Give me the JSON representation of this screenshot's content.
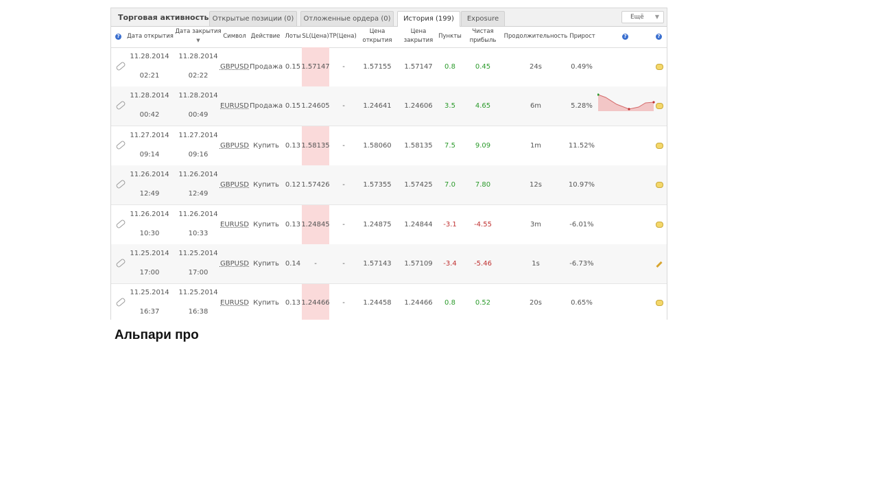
{
  "tabs": {
    "title": "Торговая активность",
    "items": [
      {
        "label": "Открытые позиции (0)"
      },
      {
        "label": "Отложенные ордера (0)"
      },
      {
        "label": "История (199)"
      },
      {
        "label": "Exposure"
      }
    ],
    "active": "История (199)",
    "more_label": "Ещё"
  },
  "columns": {
    "open_date": "Дата открытия",
    "close_date": "Дата закрытия",
    "symbol": "Символ",
    "action": "Действие",
    "lots": "Лоты",
    "sl": "SL(Цена)",
    "tp": "TP(Цена)",
    "open_price_1": "Цена",
    "open_price_2": "открытия",
    "close_price_1": "Цена",
    "close_price_2": "закрытия",
    "points": "Пункты",
    "net_profit_1": "Чистая",
    "net_profit_2": "прибыль",
    "duration": "Продолжительность",
    "growth": "Прирост"
  },
  "rows": [
    {
      "open_date": "11.28.2014",
      "open_time": "02:21",
      "close_date": "11.28.2014",
      "close_time": "02:22",
      "symbol": "GBPUSD",
      "action": "Продажа",
      "lots": "0.15",
      "sl": "1.57147",
      "tp": "-",
      "open_price": "1.57155",
      "close_price": "1.57147",
      "points": "0.8",
      "profit": "0.45",
      "duration": "24s",
      "growth": "0.49%",
      "icon": "note-icon"
    },
    {
      "open_date": "11.28.2014",
      "open_time": "00:42",
      "close_date": "11.28.2014",
      "close_time": "00:49",
      "symbol": "EURUSD",
      "action": "Продажа",
      "lots": "0.15",
      "sl": "1.24605",
      "tp": "-",
      "open_price": "1.24641",
      "close_price": "1.24606",
      "points": "3.5",
      "profit": "4.65",
      "duration": "6m",
      "growth": "5.28%",
      "icon": "note-icon"
    },
    {
      "open_date": "11.27.2014",
      "open_time": "09:14",
      "close_date": "11.27.2014",
      "close_time": "09:16",
      "symbol": "GBPUSD",
      "action": "Купить",
      "lots": "0.13",
      "sl": "1.58135",
      "tp": "-",
      "open_price": "1.58060",
      "close_price": "1.58135",
      "points": "7.5",
      "profit": "9.09",
      "duration": "1m",
      "growth": "11.52%",
      "icon": "note-icon"
    },
    {
      "open_date": "11.26.2014",
      "open_time": "12:49",
      "close_date": "11.26.2014",
      "close_time": "12:49",
      "symbol": "GBPUSD",
      "action": "Купить",
      "lots": "0.12",
      "sl": "1.57426",
      "tp": "-",
      "open_price": "1.57355",
      "close_price": "1.57425",
      "points": "7.0",
      "profit": "7.80",
      "duration": "12s",
      "growth": "10.97%",
      "icon": "note-icon"
    },
    {
      "open_date": "11.26.2014",
      "open_time": "10:30",
      "close_date": "11.26.2014",
      "close_time": "10:33",
      "symbol": "EURUSD",
      "action": "Купить",
      "lots": "0.13",
      "sl": "1.24845",
      "tp": "-",
      "open_price": "1.24875",
      "close_price": "1.24844",
      "points": "-3.1",
      "profit": "-4.55",
      "duration": "3m",
      "growth": "-6.01%",
      "icon": "note-icon"
    },
    {
      "open_date": "11.25.2014",
      "open_time": "17:00",
      "close_date": "11.25.2014",
      "close_time": "17:00",
      "symbol": "GBPUSD",
      "action": "Купить",
      "lots": "0.14",
      "sl": "-",
      "tp": "-",
      "open_price": "1.57143",
      "close_price": "1.57109",
      "points": "-3.4",
      "profit": "-5.46",
      "duration": "1s",
      "growth": "-6.73%",
      "icon": "pencil-icon"
    },
    {
      "open_date": "11.25.2014",
      "open_time": "16:37",
      "close_date": "11.25.2014",
      "close_time": "16:38",
      "symbol": "EURUSD",
      "action": "Купить",
      "lots": "0.13",
      "sl": "1.24466",
      "tp": "-",
      "open_price": "1.24458",
      "close_price": "1.24466",
      "points": "0.8",
      "profit": "0.52",
      "duration": "20s",
      "growth": "0.65%",
      "icon": "note-icon"
    }
  ],
  "caption": "Альпари про",
  "colors": {
    "positive": "#2a9a2a",
    "negative": "#c03030",
    "sl_highlight": "#fadada"
  }
}
